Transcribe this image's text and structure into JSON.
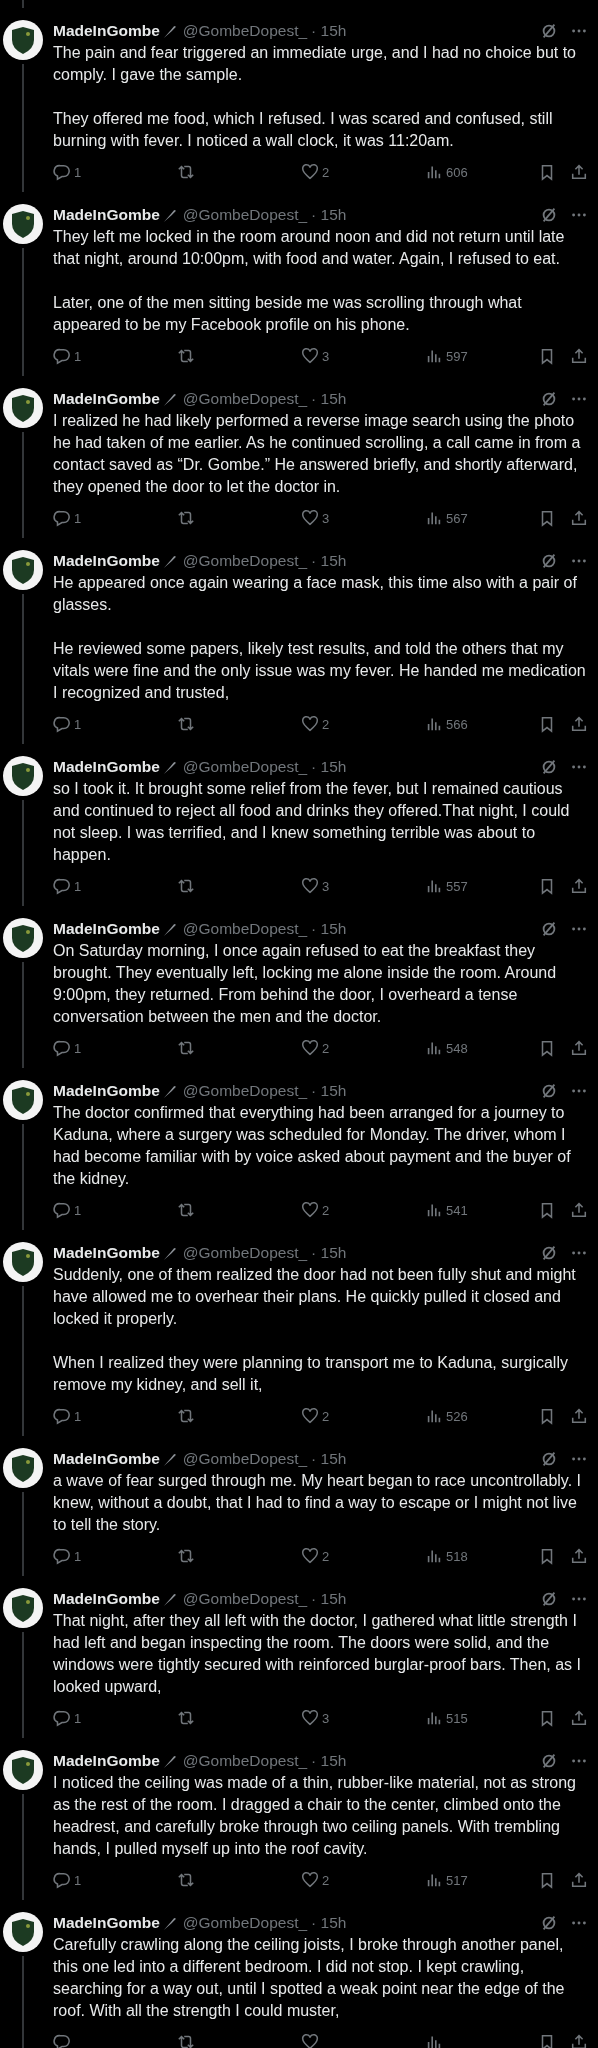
{
  "tweets": [
    {
      "author": "MadeInGombe",
      "handle": "@GombeDopest_",
      "time": "· 15h",
      "paragraphs": [
        "The pain and fear triggered an immediate urge, and I had no choice but to comply. I gave the sample.",
        "They offered me food, which I refused. I was scared and confused, still burning with fever. I noticed a wall clock, it was 11:20am."
      ],
      "replies": "1",
      "likes": "2",
      "views": "606"
    },
    {
      "author": "MadeInGombe",
      "handle": "@GombeDopest_",
      "time": "· 15h",
      "paragraphs": [
        "They left me locked in the room around noon and did not return until late that night, around 10:00pm, with food and water. Again, I refused to eat.",
        "Later, one of the men sitting beside me was scrolling through what appeared to be my Facebook profile on his phone."
      ],
      "replies": "1",
      "likes": "3",
      "views": "597"
    },
    {
      "author": "MadeInGombe",
      "handle": "@GombeDopest_",
      "time": "· 15h",
      "paragraphs": [
        "I realized he had likely performed a reverse image search using the photo he had taken of me earlier. As he continued scrolling, a call came in from a contact saved as “Dr. Gombe.” He answered briefly, and shortly afterward, they opened the door to let the doctor in."
      ],
      "replies": "1",
      "likes": "3",
      "views": "567"
    },
    {
      "author": "MadeInGombe",
      "handle": "@GombeDopest_",
      "time": "· 15h",
      "paragraphs": [
        "He appeared once again wearing a face mask, this time also with a pair of glasses.",
        "He reviewed some papers, likely test results, and told the others that my vitals were fine and the only issue was my fever. He handed me medication I recognized and trusted,"
      ],
      "replies": "1",
      "likes": "2",
      "views": "566"
    },
    {
      "author": "MadeInGombe",
      "handle": "@GombeDopest_",
      "time": "· 15h",
      "paragraphs": [
        "so I took it. It brought some relief from the fever, but I remained cautious and continued to reject all food and drinks they offered.That night, I could not sleep. I was terrified, and I knew something terrible was about to happen."
      ],
      "replies": "1",
      "likes": "3",
      "views": "557"
    },
    {
      "author": "MadeInGombe",
      "handle": "@GombeDopest_",
      "time": "· 15h",
      "paragraphs": [
        "On Saturday morning, I once again refused to eat the breakfast they brought. They eventually left, locking me alone inside the room. Around 9:00pm, they returned. From behind the door, I overheard a tense conversation between the men and the doctor."
      ],
      "replies": "1",
      "likes": "2",
      "views": "548"
    },
    {
      "author": "MadeInGombe",
      "handle": "@GombeDopest_",
      "time": "· 15h",
      "paragraphs": [
        "The doctor confirmed that everything had been arranged for a journey to Kaduna, where a surgery was scheduled for Monday. The driver, whom I had become familiar with by voice asked about payment and the buyer of the kidney."
      ],
      "replies": "1",
      "likes": "2",
      "views": "541"
    },
    {
      "author": "MadeInGombe",
      "handle": "@GombeDopest_",
      "time": "· 15h",
      "paragraphs": [
        "Suddenly, one of them realized the door had not been fully shut and might have allowed me to overhear their plans. He quickly pulled it closed and locked it properly.",
        "When I realized they were planning to transport me to Kaduna, surgically remove my kidney, and sell it,"
      ],
      "replies": "1",
      "likes": "2",
      "views": "526"
    },
    {
      "author": "MadeInGombe",
      "handle": "@GombeDopest_",
      "time": "· 15h",
      "paragraphs": [
        "a wave of fear surged through me. My heart began to race uncontrollably. I knew, without a doubt, that I had to find a way to escape or I might not live to tell the story."
      ],
      "replies": "1",
      "likes": "2",
      "views": "518"
    },
    {
      "author": "MadeInGombe",
      "handle": "@GombeDopest_",
      "time": "· 15h",
      "paragraphs": [
        "That night, after they all left with the doctor, I gathered what little strength I had left and began inspecting the room. The doors were solid, and the windows were tightly secured with reinforced burglar-proof bars. Then, as I looked upward,"
      ],
      "replies": "1",
      "likes": "3",
      "views": "515"
    },
    {
      "author": "MadeInGombe",
      "handle": "@GombeDopest_",
      "time": "· 15h",
      "paragraphs": [
        "I noticed the ceiling was made of a thin, rubber-like material, not as strong as the rest of the room. I dragged a chair to the center, climbed onto the headrest, and carefully broke through two ceiling panels. With trembling hands, I pulled myself up into the roof cavity."
      ],
      "replies": "1",
      "likes": "2",
      "views": "517"
    },
    {
      "author": "MadeInGombe",
      "handle": "@GombeDopest_",
      "time": "· 15h",
      "paragraphs": [
        "Carefully crawling along the ceiling joists, I broke through another panel, this one led into a different bedroom. I did not stop. I kept crawling, searching for a way out, until I spotted a weak point near the edge of the roof. With all the strength I could muster,"
      ]
    }
  ]
}
